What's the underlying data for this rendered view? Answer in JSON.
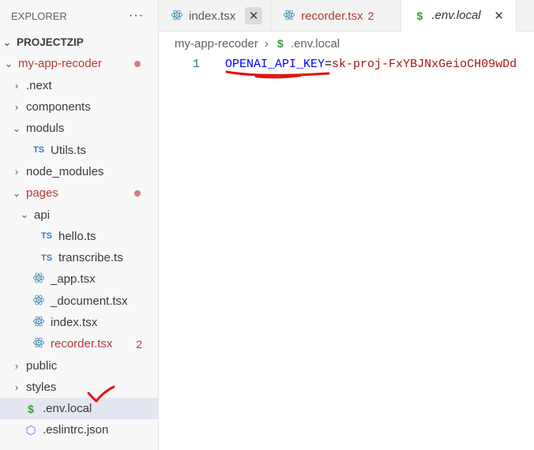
{
  "sidebar": {
    "title": "EXPLORER",
    "more": "···",
    "project": "PROJECTZIP",
    "tree": [
      {
        "label": "my-app-recoder",
        "chev": "⌄",
        "indent": 0,
        "modified": true,
        "dot": true
      },
      {
        "label": ".next",
        "chev": "›",
        "indent": 1
      },
      {
        "label": "components",
        "chev": "›",
        "indent": 1
      },
      {
        "label": "moduls",
        "chev": "⌄",
        "indent": 1
      },
      {
        "label": "Utils.ts",
        "icon": "ts",
        "indent": 2
      },
      {
        "label": "node_modules",
        "chev": "›",
        "indent": 1
      },
      {
        "label": "pages",
        "chev": "⌄",
        "indent": 1,
        "modified": true,
        "dot": true
      },
      {
        "label": "api",
        "chev": "⌄",
        "indent": 2
      },
      {
        "label": "hello.ts",
        "icon": "ts",
        "indent": 3
      },
      {
        "label": "transcribe.ts",
        "icon": "ts",
        "indent": 3
      },
      {
        "label": "_app.tsx",
        "icon": "react",
        "indent": 2
      },
      {
        "label": "_document.tsx",
        "icon": "react",
        "indent": 2
      },
      {
        "label": "index.tsx",
        "icon": "react",
        "indent": 2
      },
      {
        "label": "recorder.tsx",
        "icon": "react",
        "indent": 2,
        "modified": true,
        "count": "2"
      },
      {
        "label": "public",
        "chev": "›",
        "indent": 1
      },
      {
        "label": "styles",
        "chev": "›",
        "indent": 1
      },
      {
        "label": ".env.local",
        "icon": "dollar",
        "indent": 1,
        "selected": true
      },
      {
        "label": ".eslintrc.json",
        "icon": "eslint",
        "indent": 1
      }
    ]
  },
  "tabs": [
    {
      "label": "index.tsx",
      "icon": "react",
      "close": "✕",
      "closeHover": true
    },
    {
      "label": "recorder.tsx",
      "icon": "react",
      "modified": true,
      "count": "2"
    },
    {
      "label": ".env.local",
      "icon": "dollar",
      "active": true,
      "close": "✕"
    }
  ],
  "breadcrumb": {
    "folder": "my-app-recoder",
    "sep": "›",
    "file": ".env.local"
  },
  "editor": {
    "line_number": "1",
    "key": "OPENAI_API_KEY",
    "eq": "=",
    "value": "sk-proj-FxYBJNxGeioCH09wDd"
  },
  "colors": {
    "modified": "#b33a36",
    "annotation": "#e3120b"
  },
  "icons": {
    "ts": "TS",
    "dollar": "$",
    "eslint": "⬡"
  }
}
